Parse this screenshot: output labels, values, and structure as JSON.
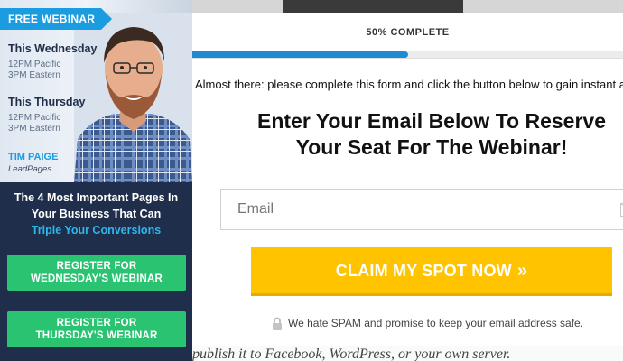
{
  "sidebar": {
    "badge": "FREE WEBINAR",
    "sessions": [
      {
        "day": "This Wednesday",
        "time1": "12PM Pacific",
        "time2": "3PM Eastern"
      },
      {
        "day": "This Thursday",
        "time1": "12PM Pacific",
        "time2": "3PM Eastern"
      }
    ],
    "host_name": "TIM PAIGE",
    "host_company": "LeadPages",
    "pitch_line1": "The 4 Most Important Pages In",
    "pitch_line2": "Your Business That Can",
    "pitch_highlight": "Triple Your Conversions",
    "buttons": [
      {
        "line1": "REGISTER FOR",
        "line2": "WEDNESDAY'S WEBINAR"
      },
      {
        "line1": "REGISTER FOR",
        "line2": "THURSDAY'S WEBINAR"
      }
    ],
    "colors": {
      "badge": "#1b9be0",
      "button": "#2ac372",
      "panel": "#1f2e4a",
      "highlight": "#2fb7ec"
    }
  },
  "background_page": {
    "text": "publish it to Facebook, WordPress, or your own server."
  },
  "modal": {
    "progress_label": "50% COMPLETE",
    "progress": 0.5,
    "subtext": "Almost there: please complete this form and click the button below to gain instant access.",
    "headline_line1": "Enter Your Email Below To Reserve",
    "headline_line2": "Your Seat For The Webinar!",
    "email_placeholder": "Email",
    "email_value": "",
    "email_icon": "envelope-icon",
    "cta_label": "CLAIM MY SPOT NOW",
    "cta_arrows": "»",
    "spam_note": "We hate SPAM and promise to keep your email address safe.",
    "spam_icon": "lock-icon",
    "colors": {
      "progress": "#1e8ad3",
      "cta": "#ffc300"
    }
  }
}
